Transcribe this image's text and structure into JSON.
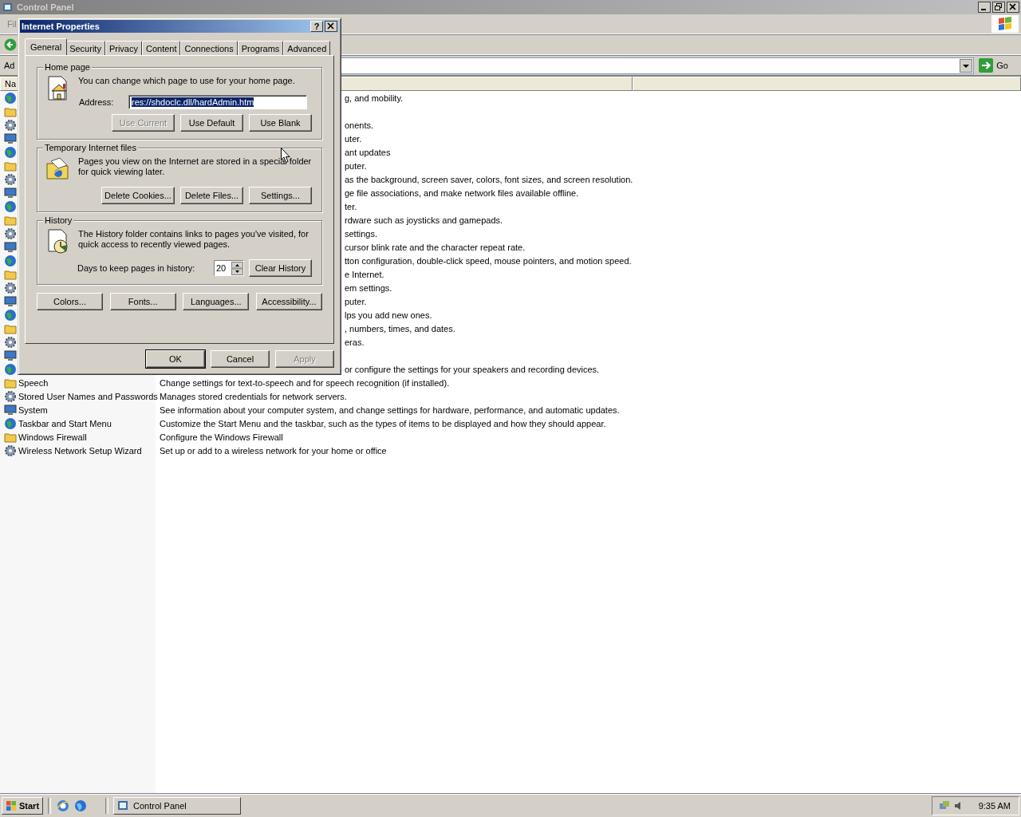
{
  "window": {
    "title": "Control Panel"
  },
  "menu_bar": {
    "items": [
      "Fil"
    ]
  },
  "address_bar": {
    "label": "Ad",
    "go": "Go"
  },
  "columns": [
    "Na"
  ],
  "rows": [
    {
      "kind": "covered",
      "description": "g, and mobility."
    },
    {
      "kind": "covered"
    },
    {
      "kind": "covered",
      "description": "onents."
    },
    {
      "kind": "covered",
      "description": "uter."
    },
    {
      "kind": "covered",
      "description": "ant updates"
    },
    {
      "kind": "covered",
      "description": "puter."
    },
    {
      "kind": "covered",
      "description": "as the background, screen saver, colors, font sizes, and screen resolution."
    },
    {
      "kind": "covered",
      "description": "ge file associations, and make network files available offline."
    },
    {
      "kind": "covered",
      "description": "ter."
    },
    {
      "kind": "covered",
      "description": "rdware such as joysticks and gamepads."
    },
    {
      "kind": "covered",
      "description": "settings."
    },
    {
      "kind": "covered",
      "description": "cursor blink rate and the character repeat rate."
    },
    {
      "kind": "covered",
      "description": "tton configuration, double-click speed, mouse pointers, and motion speed."
    },
    {
      "kind": "covered",
      "description": "e Internet."
    },
    {
      "kind": "covered",
      "description": "em settings."
    },
    {
      "kind": "covered",
      "description": "puter."
    },
    {
      "kind": "covered",
      "description": "lps you add new ones."
    },
    {
      "kind": "covered",
      "description": ", numbers, times, and dates."
    },
    {
      "kind": "covered",
      "description": "eras."
    },
    {
      "kind": "covered"
    },
    {
      "kind": "covered",
      "description": "or configure the settings for your speakers and recording devices."
    },
    {
      "kind": "full",
      "name": "Speech",
      "description": "Change settings for text-to-speech and for speech recognition (if installed)."
    },
    {
      "kind": "full",
      "name": "Stored User Names and Passwords",
      "description": "Manages stored credentials for network servers."
    },
    {
      "kind": "full",
      "name": "System",
      "description": "See information about your computer system, and change settings for hardware, performance, and automatic updates."
    },
    {
      "kind": "full",
      "name": "Taskbar and Start Menu",
      "description": "Customize the Start Menu and the taskbar, such as the types of items to be displayed and how they should appear."
    },
    {
      "kind": "full",
      "name": "Windows Firewall",
      "description": "Configure the Windows Firewall"
    },
    {
      "kind": "full",
      "name": "Wireless Network Setup Wizard",
      "description": "Set up or add to a wireless network for your home or office"
    }
  ],
  "dialog": {
    "title": "Internet Properties",
    "help": "?",
    "tabs": [
      {
        "label": "General",
        "selected": true
      },
      {
        "label": "Security",
        "selected": false
      },
      {
        "label": "Privacy",
        "selected": false
      },
      {
        "label": "Content",
        "selected": false
      },
      {
        "label": "Connections",
        "selected": false
      },
      {
        "label": "Programs",
        "selected": false
      },
      {
        "label": "Advanced",
        "selected": false
      }
    ],
    "home_page": {
      "legend": "Home page",
      "text": "You can change which page to use for your home page.",
      "address_label": "Address:",
      "address_value": "res://shdoclc.dll/hardAdmin.htm",
      "value_selected": true,
      "buttons": [
        {
          "label": "Use Current",
          "disabled": true
        },
        {
          "label": "Use Default",
          "disabled": false
        },
        {
          "label": "Use Blank",
          "disabled": false
        }
      ]
    },
    "temporary_files": {
      "legend": "Temporary Internet files",
      "text": "Pages you view on the Internet are stored in a special folder for quick viewing later.",
      "buttons": [
        {
          "label": "Delete Cookies...",
          "disabled": false
        },
        {
          "label": "Delete Files...",
          "disabled": false
        },
        {
          "label": "Settings...",
          "disabled": false
        }
      ]
    },
    "history": {
      "legend": "History",
      "text": "The History folder contains links to pages you've visited, for quick access to recently viewed pages.",
      "days_label": "Days to keep pages in history:",
      "days_value": "20",
      "buttons": [
        {
          "label": "Clear History",
          "disabled": false
        }
      ]
    },
    "extra_buttons": [
      {
        "label": "Colors...",
        "disabled": false
      },
      {
        "label": "Fonts...",
        "disabled": false
      },
      {
        "label": "Languages...",
        "disabled": false
      },
      {
        "label": "Accessibility...",
        "disabled": false
      }
    ],
    "footer_buttons": [
      {
        "label": "OK",
        "default": true,
        "disabled": false
      },
      {
        "label": "Cancel",
        "default": false,
        "disabled": false
      },
      {
        "label": "Apply",
        "default": false,
        "disabled": true
      }
    ]
  },
  "taskbar": {
    "start": "Start",
    "tasks": [
      {
        "label": "Control Panel",
        "selected": false
      }
    ],
    "clock": "9:35 AM"
  }
}
